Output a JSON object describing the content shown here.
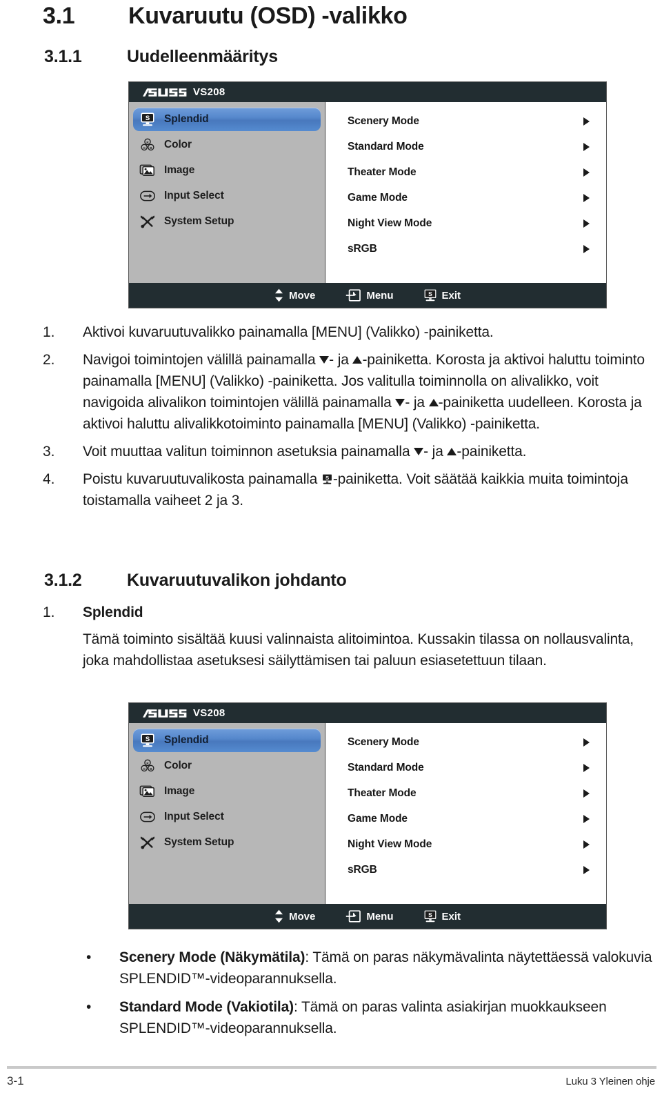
{
  "headings": {
    "h1_number": "3.1",
    "h1_title": "Kuvaruutu (OSD) -valikko",
    "h2_number": "3.1.1",
    "h2_title": "Uudelleenmääritys",
    "h2b_number": "3.1.2",
    "h2b_title": "Kuvaruutuvalikon johdanto"
  },
  "osd": {
    "brand": "ASUS",
    "model": "VS208",
    "sidebar": [
      {
        "label": "Splendid",
        "icon": "splendid-monitor-icon",
        "active": true
      },
      {
        "label": "Color",
        "icon": "color-rgb-icon",
        "active": false
      },
      {
        "label": "Image",
        "icon": "image-picture-icon",
        "active": false
      },
      {
        "label": "Input Select",
        "icon": "input-select-arrow-icon",
        "active": false
      },
      {
        "label": "System Setup",
        "icon": "system-setup-tools-icon",
        "active": false
      }
    ],
    "menu": [
      {
        "label": "Scenery Mode"
      },
      {
        "label": "Standard Mode"
      },
      {
        "label": "Theater Mode"
      },
      {
        "label": "Game Mode"
      },
      {
        "label": "Night View Mode"
      },
      {
        "label": "sRGB"
      }
    ],
    "footer": {
      "move": "Move",
      "menu": "Menu",
      "exit": "Exit"
    },
    "colors": {
      "highlight_blue": "#5688cc",
      "sidebar_gray": "#b7b7b7",
      "chrome_dark": "#222d31"
    }
  },
  "steps": [
    {
      "marker": "1.",
      "segments": [
        {
          "type": "text",
          "value": "Aktivoi kuvaruutuvalikko painamalla [MENU] (Valikko) -painiketta."
        }
      ]
    },
    {
      "marker": "2.",
      "segments": [
        {
          "type": "text",
          "value": "Navigoi toimintojen välillä painamalla "
        },
        {
          "type": "icon",
          "value": "triangle-down-icon"
        },
        {
          "type": "text",
          "value": "- ja "
        },
        {
          "type": "icon",
          "value": "triangle-up-icon"
        },
        {
          "type": "text",
          "value": "-painiketta. Korosta ja aktivoi haluttu toiminto painamalla [MENU] (Valikko) -painiketta. Jos valitulla toiminnolla on alivalikko, voit navigoida alivalikon toimintojen välillä painamalla "
        },
        {
          "type": "icon",
          "value": "triangle-down-icon"
        },
        {
          "type": "text",
          "value": "- ja "
        },
        {
          "type": "icon",
          "value": "triangle-up-icon"
        },
        {
          "type": "text",
          "value": "-painiketta uudelleen. Korosta ja aktivoi haluttu alivalikkotoiminto painamalla [MENU] (Valikko) -painiketta."
        }
      ]
    },
    {
      "marker": "3.",
      "segments": [
        {
          "type": "text",
          "value": "Voit muuttaa valitun toiminnon asetuksia painamalla "
        },
        {
          "type": "icon",
          "value": "triangle-down-icon"
        },
        {
          "type": "text",
          "value": "- ja "
        },
        {
          "type": "icon",
          "value": "triangle-up-icon"
        },
        {
          "type": "text",
          "value": "-painiketta."
        }
      ]
    },
    {
      "marker": "4.",
      "segments": [
        {
          "type": "text",
          "value": "Poistu kuvaruutuvalikosta painamalla "
        },
        {
          "type": "icon",
          "value": "splendid-s-button-icon"
        },
        {
          "type": "text",
          "value": "-painiketta. Voit säätää kaikkia muita toimintoja toistamalla vaiheet 2 ja 3."
        }
      ]
    }
  ],
  "section2": {
    "item_marker": "1.",
    "item_title": "Splendid",
    "paragraph": "Tämä toiminto sisältää kuusi valinnaista alitoimintoa. Kussakin tilassa on nollausvalinta, joka mahdollistaa asetuksesi säilyttämisen tai paluun esiasetettuun tilaan."
  },
  "bullets": [
    {
      "bullet": "•",
      "bold": "Scenery Mode (Näkymätila)",
      "rest": ": Tämä on paras näkymävalinta näytettäessä valokuvia SPLENDID™-videoparannuksella."
    },
    {
      "bullet": "•",
      "bold": "Standard Mode (Vakiotila)",
      "rest": ": Tämä on paras valinta asiakirjan muokkaukseen SPLENDID™-videoparannuksella."
    }
  ],
  "page_footer": {
    "page_number": "3-1",
    "chapter": "Luku 3 Yleinen ohje"
  }
}
